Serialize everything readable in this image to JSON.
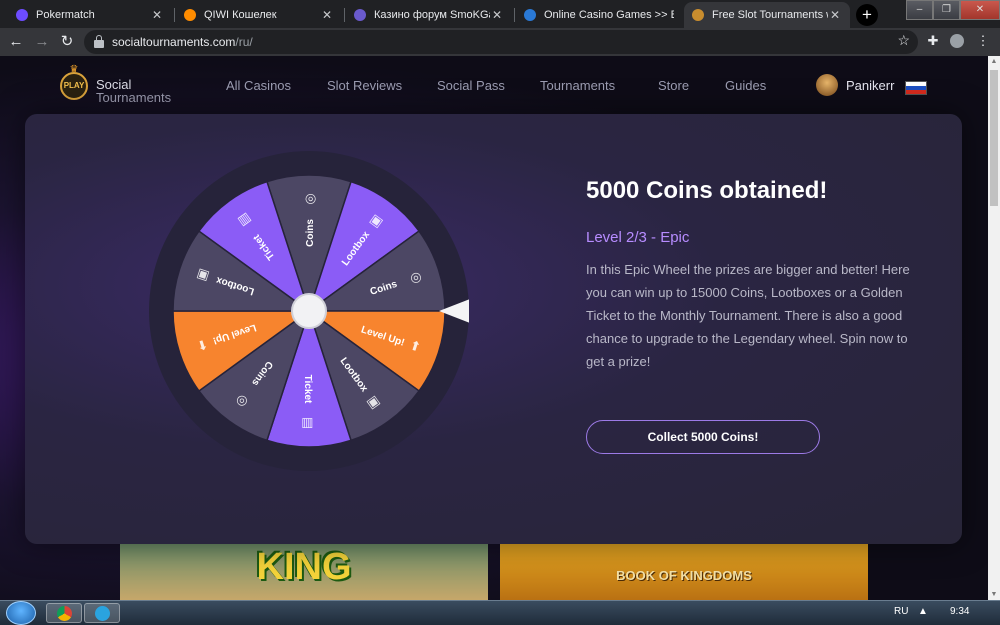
{
  "browser": {
    "tabs": [
      {
        "title": "Pokermatch",
        "active": false,
        "favicon_color": "#6d4cff"
      },
      {
        "title": "QIWI Кошелек",
        "active": false,
        "favicon_color": "#ff8c00"
      },
      {
        "title": "Казино форум SmoKGames",
        "active": false,
        "favicon_color": "#6a5acd"
      },
      {
        "title": "Online Casino Games >> Bo",
        "active": false,
        "favicon_color": "#2a79d6"
      },
      {
        "title": "Free Slot Tournaments with",
        "active": true,
        "favicon_color": "#c98d2e"
      }
    ],
    "new_tab_label": "+",
    "url_host": "socialtournaments.com",
    "url_path": "/ru/"
  },
  "site": {
    "logo_badge": "PLAY",
    "logo_line1": "Social",
    "logo_line2": "Tournaments",
    "nav": [
      "All Casinos",
      "Slot Reviews",
      "Social Pass",
      "Tournaments",
      "Store",
      "Guides"
    ],
    "username": "Panikerr"
  },
  "wheel": {
    "segments": [
      {
        "label": "Coins",
        "icon": "coins-icon",
        "color": "#4c4764"
      },
      {
        "label": "Lootbox",
        "icon": "lootbox-icon",
        "color": "#8b5cf6"
      },
      {
        "label": "Coins",
        "icon": "coins-icon",
        "color": "#4c4764"
      },
      {
        "label": "Level Up!",
        "icon": "level-up-icon",
        "color": "#f7842e"
      },
      {
        "label": "Lootbox",
        "icon": "lootbox-icon",
        "color": "#4c4764"
      },
      {
        "label": "Ticket",
        "icon": "ticket-icon",
        "color": "#8b5cf6"
      },
      {
        "label": "Coins",
        "icon": "coins-icon",
        "color": "#4c4764"
      },
      {
        "label": "Level Up!",
        "icon": "level-up-icon",
        "color": "#f7842e"
      },
      {
        "label": "Lootbox",
        "icon": "lootbox-icon",
        "color": "#4c4764"
      },
      {
        "label": "Ticket",
        "icon": "ticket-icon",
        "color": "#8b5cf6"
      }
    ]
  },
  "result": {
    "title": "5000 Coins obtained!",
    "level": "Level 2/3 - Epic",
    "description": "In this Epic Wheel the prizes are bigger and better! Here you can win up to 15000 Coins, Lootboxes or a Golden Ticket to the Monthly Tournament. There is also a good chance to upgrade to the Legendary wheel. Spin now to get a prize!",
    "button_label": "Collect 5000 Coins!"
  },
  "thumbs": {
    "king": "KING",
    "book": "BOOK OF KINGDOMS"
  },
  "taskbar": {
    "lang": "RU",
    "time": "9:34"
  },
  "colors": {
    "accent_purple": "#8b5cf6",
    "accent_orange": "#f7842e",
    "level_text": "#b78cff"
  }
}
